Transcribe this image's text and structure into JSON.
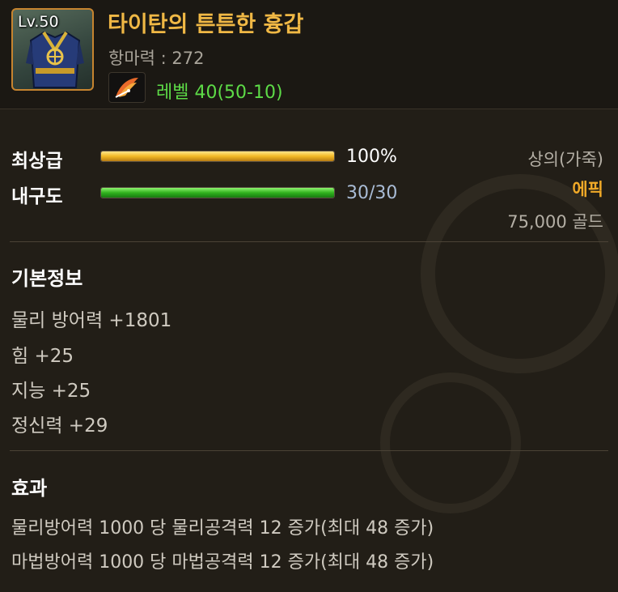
{
  "colors": {
    "title": "#f0b845",
    "level_req": "#5ddb47",
    "rarity": "#f0a928",
    "grade_bar": "#f2b925",
    "durability_bar": "#30b21e",
    "durability_value": "#a9bcd6"
  },
  "item": {
    "level_badge": "Lv.50",
    "icon": "armor-chest-icon",
    "name": "타이탄의 튼튼한 흉갑",
    "stat": "항마력 : 272",
    "requirement_icon": "wing-feather-icon",
    "requirement": "레벨 40(50-10)"
  },
  "bars": {
    "grade": {
      "label": "최상급",
      "value": "100%",
      "fill": 1.0
    },
    "durability": {
      "label": "내구도",
      "value": "30/30",
      "fill": 1.0
    }
  },
  "meta": {
    "type": "상의(가죽)",
    "rarity": "에픽",
    "price": "75,000 골드"
  },
  "basic_info": {
    "title": "기본정보",
    "lines": [
      "물리 방어력 +1801",
      "힘 +25",
      "지능 +25",
      "정신력 +29"
    ]
  },
  "effects": {
    "title": "효과",
    "lines": [
      "물리방어력 1000 당 물리공격력 12 증가(최대 48 증가)",
      "마법방어력 1000 당 마법공격력 12 증가(최대 48 증가)"
    ]
  }
}
